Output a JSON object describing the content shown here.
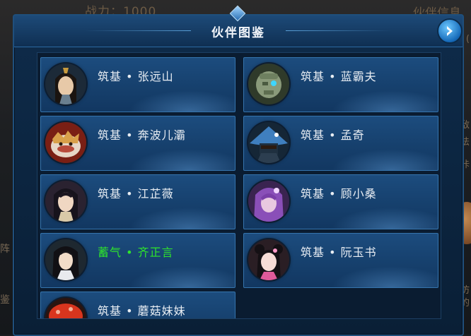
{
  "background": {
    "power_text": "战力：1000",
    "partner_info_text": "伙伴信息",
    "left_chars": [
      "阵",
      "鉴"
    ],
    "right_chars": [
      "(",
      "敌",
      "法",
      "咔",
      "仿",
      "的"
    ]
  },
  "dialog": {
    "title": "伙伴图鉴",
    "next_button_icon": "arrow-right-icon"
  },
  "partners": [
    {
      "name": "筑基 • 张远山",
      "color": "#e8edf3",
      "avatar_icon": "swordsman-icon"
    },
    {
      "name": "筑基 • 蓝霸夫",
      "color": "#e8edf3",
      "avatar_icon": "stone-golem-icon"
    },
    {
      "name": "筑基 • 奔波儿灞",
      "color": "#e8edf3",
      "avatar_icon": "fish-demon-icon"
    },
    {
      "name": "筑基 • 孟奇",
      "color": "#e8edf3",
      "avatar_icon": "straw-hat-icon"
    },
    {
      "name": "筑基 • 江芷薇",
      "color": "#e8edf3",
      "avatar_icon": "lady-icon"
    },
    {
      "name": "筑基 • 顾小桑",
      "color": "#e8edf3",
      "avatar_icon": "purple-hair-girl-icon"
    },
    {
      "name": "蓄气 • 齐正言",
      "color": "#2ee52b",
      "avatar_icon": "scholar-icon"
    },
    {
      "name": "筑基 • 阮玉书",
      "color": "#e8edf3",
      "avatar_icon": "pink-girl-icon"
    },
    {
      "name": "筑基 • 蘑菇妹妹",
      "color": "#e8edf3",
      "avatar_icon": "mushroom-girl-icon"
    }
  ]
}
